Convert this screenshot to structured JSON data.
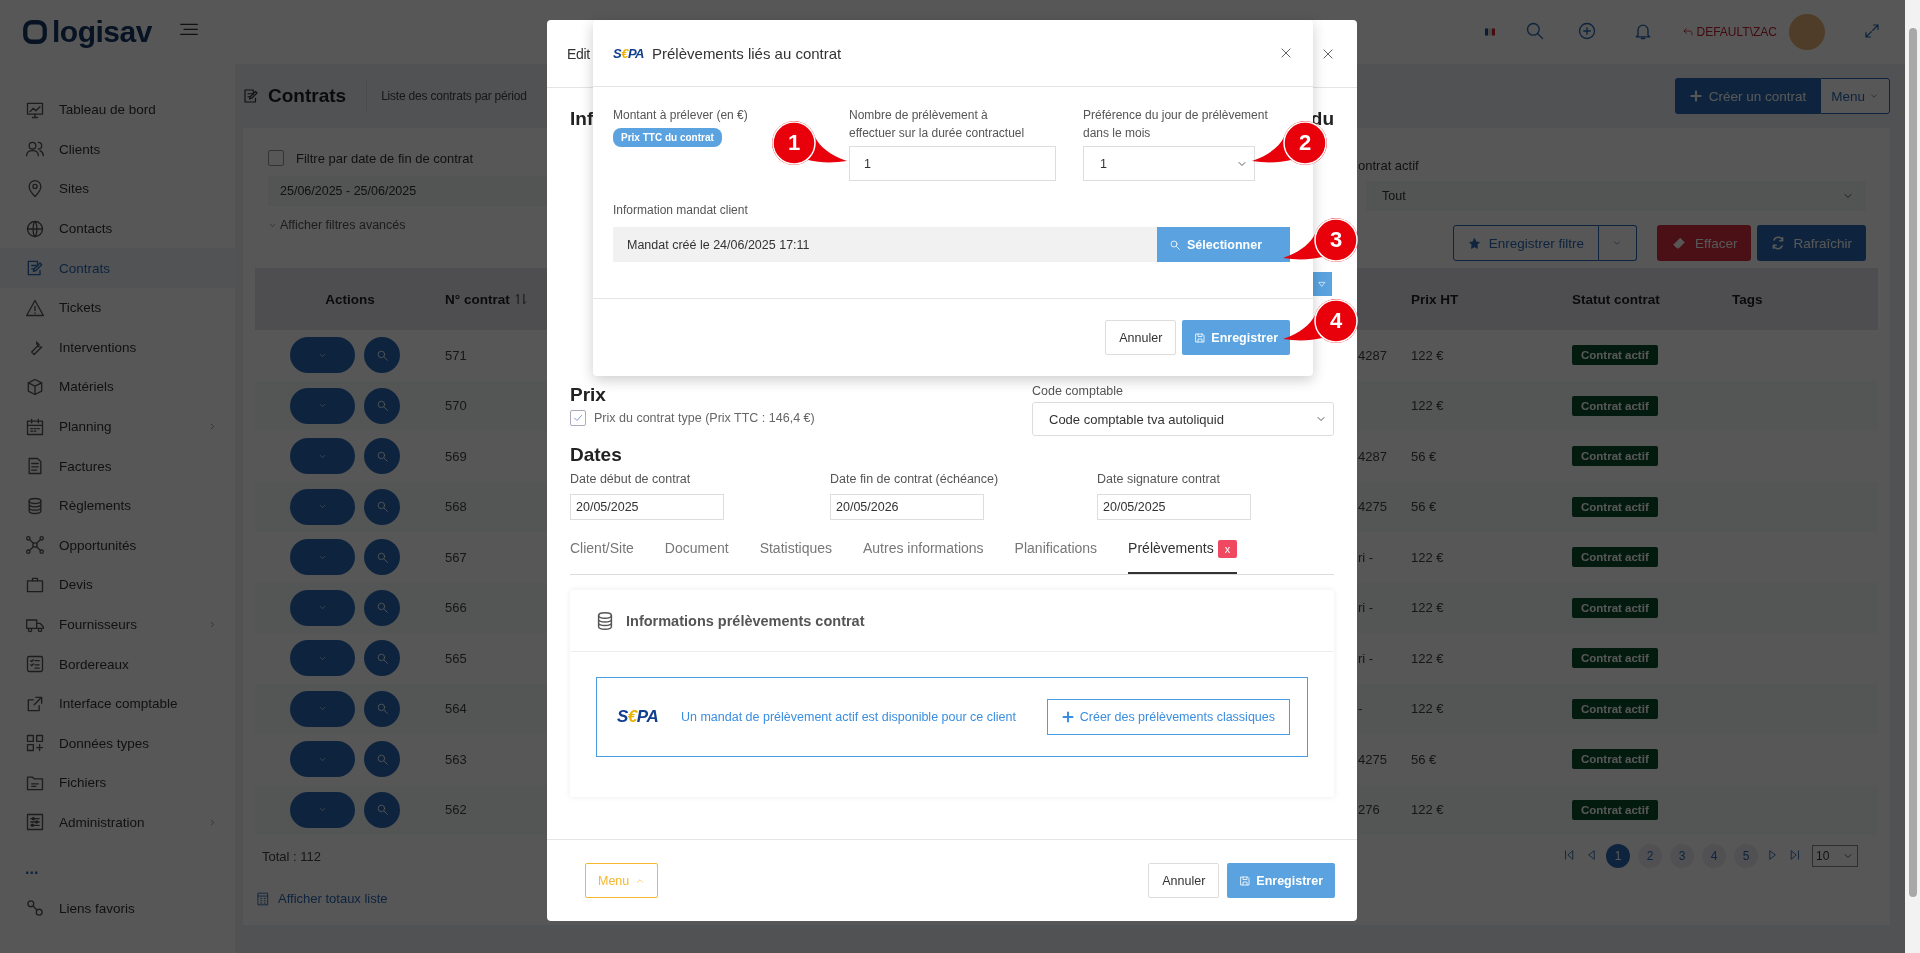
{
  "topbar": {
    "logo": "logisav",
    "user": "DEFAULT\\ZAC"
  },
  "sidebar": {
    "items": [
      {
        "label": "Tableau de bord",
        "selected": false,
        "has_submenu": false
      },
      {
        "label": "Clients",
        "selected": false,
        "has_submenu": false
      },
      {
        "label": "Sites",
        "selected": false,
        "has_submenu": false
      },
      {
        "label": "Contacts",
        "selected": false,
        "has_submenu": false
      },
      {
        "label": "Contrats",
        "selected": true,
        "has_submenu": false
      },
      {
        "label": "Tickets",
        "selected": false,
        "has_submenu": false
      },
      {
        "label": "Interventions",
        "selected": false,
        "has_submenu": false
      },
      {
        "label": "Matériels",
        "selected": false,
        "has_submenu": false
      },
      {
        "label": "Planning",
        "selected": false,
        "has_submenu": true
      },
      {
        "label": "Factures",
        "selected": false,
        "has_submenu": false
      },
      {
        "label": "Règlements",
        "selected": false,
        "has_submenu": false
      },
      {
        "label": "Opportunités",
        "selected": false,
        "has_submenu": false
      },
      {
        "label": "Devis",
        "selected": false,
        "has_submenu": false
      },
      {
        "label": "Fournisseurs",
        "selected": false,
        "has_submenu": true
      },
      {
        "label": "Bordereaux",
        "selected": false,
        "has_submenu": false
      },
      {
        "label": "Interface comptable",
        "selected": false,
        "has_submenu": false
      },
      {
        "label": "Données types",
        "selected": false,
        "has_submenu": false
      },
      {
        "label": "Fichiers",
        "selected": false,
        "has_submenu": false
      },
      {
        "label": "Administration",
        "selected": false,
        "has_submenu": true
      }
    ],
    "more": "...",
    "favorites": "Liens favoris"
  },
  "page": {
    "title": "Contrats",
    "subtitle": "Liste des contrats par périod",
    "create_button": "Créer un contrat",
    "menu_button": "Menu"
  },
  "filters": {
    "date_filter": {
      "label": "Filtre par date de fin de contrat",
      "checked": false
    },
    "date_range": "25/06/2025 - 25/06/2025",
    "advanced_link": "Afficher filtres avancés",
    "active_label": "ontrat actif",
    "active_select": "Tout",
    "save_filter": "Enregistrer filtre",
    "clear": "Effacer",
    "refresh": "Rafraîchir"
  },
  "table": {
    "columns": [
      "Actions",
      "N° contrat",
      "Prix HT",
      "Statut contrat",
      "Tags"
    ],
    "rows": [
      {
        "number": "571",
        "column_3": "4287",
        "price": "122 €",
        "status": "Contrat actif"
      },
      {
        "number": "570",
        "price": "122 €",
        "status": "Contrat actif"
      },
      {
        "number": "569",
        "column_3": "4287",
        "price": "56 €",
        "status": "Contrat actif"
      },
      {
        "number": "568",
        "column_3": "4275",
        "price": "56 €",
        "status": "Contrat actif"
      },
      {
        "number": "567",
        "column_3": "ri -",
        "price": "122 €",
        "status": "Contrat actif"
      },
      {
        "number": "566",
        "column_3": "ri -",
        "price": "122 €",
        "status": "Contrat actif"
      },
      {
        "number": "565",
        "column_3": "ri -",
        "price": "122 €",
        "status": "Contrat actif"
      },
      {
        "number": "564",
        "column_3": "-",
        "price": "122 €",
        "status": "Contrat actif"
      },
      {
        "number": "563",
        "column_3": "4275",
        "price": "56 €",
        "status": "Contrat actif"
      },
      {
        "number": "562",
        "column_3": "276",
        "price": "122 €",
        "status": "Contrat actif"
      }
    ],
    "total": "Total : 112",
    "pagination": {
      "pages": [
        {
          "label": "1",
          "selected": true
        },
        {
          "label": "2",
          "selected": false
        },
        {
          "label": "3",
          "selected": false
        },
        {
          "label": "4",
          "selected": false
        },
        {
          "label": "5",
          "selected": false
        }
      ],
      "page_size": "10"
    },
    "totals_link": "Afficher totaux liste"
  },
  "edit_dialog": {
    "title": "Edit",
    "heading": "Inf",
    "heading_right": "du",
    "price": {
      "heading": "Prix",
      "checkbox": {
        "label": "Prix du contrat type (Prix TTC : 146,4 €)",
        "checked": true
      }
    },
    "accounting": {
      "label": "Code comptable",
      "value": "Code comptable tva autoliquid"
    },
    "dates": {
      "heading": "Dates",
      "fields": [
        {
          "label": "Date début de contrat",
          "value": "20/05/2025"
        },
        {
          "label": "Date fin de contrat (échéance)",
          "value": "20/05/2026"
        },
        {
          "label": "Date signature contrat",
          "value": "20/05/2025"
        }
      ]
    },
    "tabs": [
      {
        "label": "Client/Site",
        "selected": false
      },
      {
        "label": "Document",
        "selected": false
      },
      {
        "label": "Statistiques",
        "selected": false
      },
      {
        "label": "Autres informations",
        "selected": false
      },
      {
        "label": "Planifications",
        "selected": false
      },
      {
        "label": "Prélèvements",
        "selected": true,
        "badge": "x"
      }
    ],
    "card": {
      "title": "Informations prélèvements contrat",
      "sepa_logo": "S€PA",
      "message": "Un mandat de prélèvement actif est disponible pour ce client",
      "button": "Créer des prélèvements classiques"
    },
    "footer": {
      "menu": "Menu",
      "cancel": "Annuler",
      "save": "Enregistrer"
    }
  },
  "sepa_dialog": {
    "logo": "S€PA",
    "title": "Prélèvements liés au contrat",
    "amount": {
      "label": "Montant à prélever (en €)",
      "badge": "Prix TTC du contrat"
    },
    "count": {
      "label": "Nombre de prélèvement à effectuer sur la durée contractuel",
      "value": "1"
    },
    "day": {
      "label": "Préférence du jour de prélèvement dans le mois",
      "value": "1"
    },
    "mandate": {
      "label": "Information mandat client",
      "value": "Mandat créé le 24/06/2025 17:11",
      "button": "Sélectionner"
    },
    "cancel": "Annuler",
    "save": "Enregistrer"
  },
  "callouts": [
    {
      "number": "1"
    },
    {
      "number": "2"
    },
    {
      "number": "3"
    },
    {
      "number": "4"
    }
  ]
}
